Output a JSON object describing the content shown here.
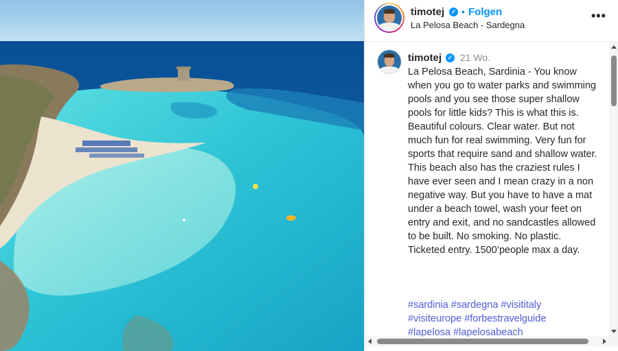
{
  "post": {
    "image_alt": "Aerial view of La Pelosa Beach with turquoise water and a watchtower",
    "author": {
      "username": "timotej",
      "verified_icon": "verified-badge-icon",
      "verified_glyph": "✓",
      "follow_separator": "•",
      "follow_label": "Folgen",
      "location": "La Pelosa Beach - Sardegna",
      "more_label": "•••"
    },
    "caption": {
      "username": "timotej",
      "time": "21 Wo.",
      "text": "La Pelosa Beach, Sardinia - You know when you go to water parks and swimming pools and you see those super shallow pools for little kids? This is what this is. Beautiful colours. Clear water. But not much fun for real swimming. Very fun for sports that require sand and shallow water. This beach also has the craziest rules I have ever seen and I mean crazy in a non negative way. But you have to have a mat under a beach towel, wash your feet on entry and exit, and no sandcastles allowed to be built. No smoking. No plastic. Ticketed entry. 1500’people max a day.",
      "hashtags": [
        "#sardinia",
        "#sardegna",
        "#visititaly",
        "#visiteurope",
        "#forbestravelguide",
        "#lapelosa",
        "#lapelosabeach"
      ]
    }
  },
  "colors": {
    "accent": "#0095f6",
    "hashtag": "#4f5bd5",
    "text": "#262626",
    "muted": "#8e8e8e"
  }
}
